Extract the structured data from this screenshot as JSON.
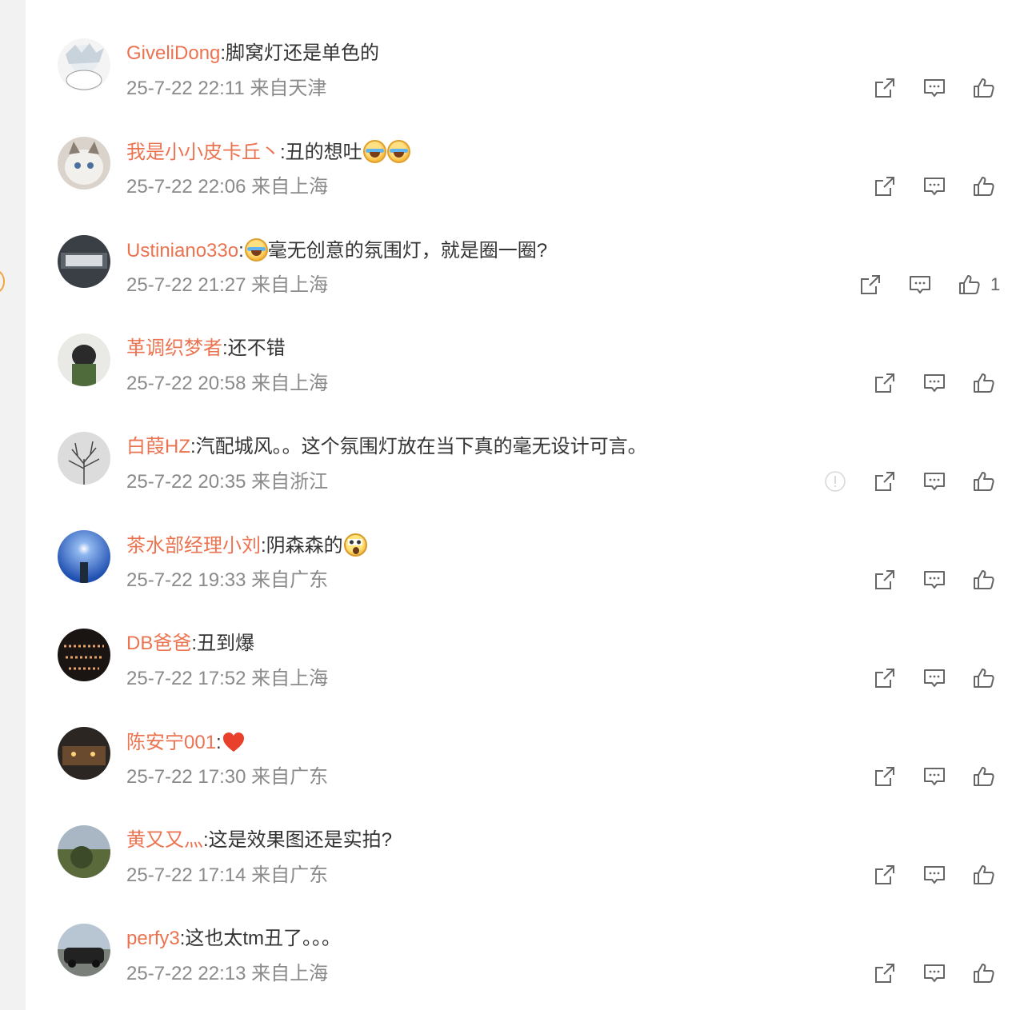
{
  "colors": {
    "username": "#eb7350",
    "text": "#333333",
    "meta": "#8a8a8a",
    "icon": "#666666"
  },
  "comments": [
    {
      "user": "GiveliDong",
      "text": ":脚窝灯还是单色的",
      "time": "25-7-22 22:11",
      "location": "来自天津"
    },
    {
      "user": "我是小小皮卡丘丶",
      "text": ":丑的想吐",
      "time": "25-7-22 22:06",
      "location": "来自上海"
    },
    {
      "user": "Ustiniano33o",
      "text": "毫无创意的氛围灯，就是圈一圈?",
      "time": "25-7-22 21:27",
      "location": "来自上海",
      "likes": "1"
    },
    {
      "user": "革调织梦者",
      "text": ":还不错",
      "time": "25-7-22 20:58",
      "location": "来自上海"
    },
    {
      "user": "白葭HZ",
      "text": ":汽配城风。。这个氛围灯放在当下真的毫无设计可言。",
      "time": "25-7-22 20:35",
      "location": "来自浙江"
    },
    {
      "user": "茶水部经理小刘",
      "text": ":阴森森的",
      "time": "25-7-22 19:33",
      "location": "来自广东"
    },
    {
      "user": "DB爸爸",
      "text": ":丑到爆",
      "time": "25-7-22 17:52",
      "location": "来自上海"
    },
    {
      "user": "陈安宁001",
      "text": ":",
      "time": "25-7-22 17:30",
      "location": "来自广东"
    },
    {
      "user": "黄又又灬",
      "text": ":这是效果图还是实拍?",
      "time": "25-7-22 17:14",
      "location": "来自广东"
    },
    {
      "user": "perfy3",
      "text": ":这也太tm丑了。。。",
      "time": "25-7-22 22:13",
      "location": "来自上海"
    }
  ],
  "icons": {
    "share": "share-icon",
    "reply": "comment-icon",
    "like": "thumbs-up-icon",
    "report": "report-icon"
  }
}
